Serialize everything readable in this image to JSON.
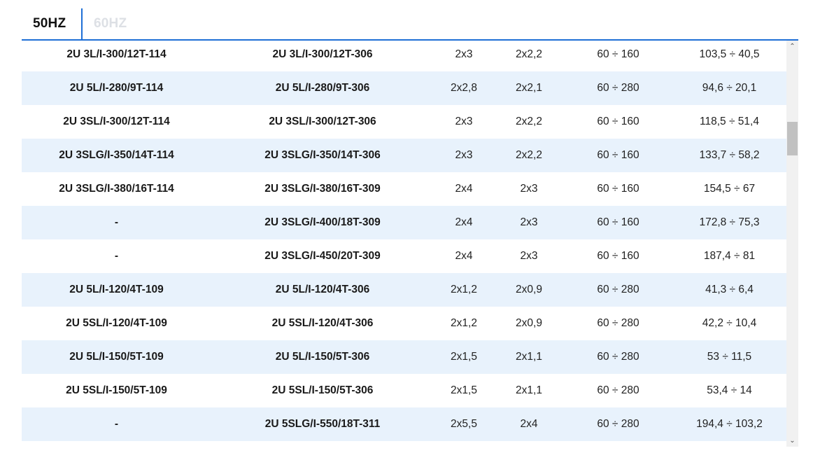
{
  "tabs": [
    {
      "label": "50HZ",
      "active": true
    },
    {
      "label": "60HZ",
      "active": false
    }
  ],
  "colors": {
    "accent": "#1f6fd6",
    "row_alt": "#e8f2fc",
    "inactive_tab": "#dde0e5"
  },
  "rows": [
    {
      "m1": "2U 3L/I-300/12T-114",
      "m2": "2U 3L/I-300/12T-306",
      "a": "2x3",
      "b": "2x2,2",
      "c": "60 ÷ 160",
      "d": "103,5 ÷ 40,5"
    },
    {
      "m1": "2U 5L/I-280/9T-114",
      "m2": "2U 5L/I-280/9T-306",
      "a": "2x2,8",
      "b": "2x2,1",
      "c": "60 ÷ 280",
      "d": "94,6 ÷ 20,1"
    },
    {
      "m1": "2U 3SL/I-300/12T-114",
      "m2": "2U 3SL/I-300/12T-306",
      "a": "2x3",
      "b": "2x2,2",
      "c": "60 ÷ 160",
      "d": "118,5 ÷ 51,4"
    },
    {
      "m1": "2U 3SLG/I-350/14T-114",
      "m2": "2U 3SLG/I-350/14T-306",
      "a": "2x3",
      "b": "2x2,2",
      "c": "60 ÷ 160",
      "d": "133,7 ÷ 58,2"
    },
    {
      "m1": "2U 3SLG/I-380/16T-114",
      "m2": "2U 3SLG/I-380/16T-309",
      "a": "2x4",
      "b": "2x3",
      "c": "60 ÷ 160",
      "d": "154,5 ÷ 67"
    },
    {
      "m1": "-",
      "m2": "2U 3SLG/I-400/18T-309",
      "a": "2x4",
      "b": "2x3",
      "c": "60 ÷ 160",
      "d": "172,8 ÷ 75,3"
    },
    {
      "m1": "-",
      "m2": "2U 3SLG/I-450/20T-309",
      "a": "2x4",
      "b": "2x3",
      "c": "60 ÷ 160",
      "d": "187,4 ÷ 81"
    },
    {
      "m1": "2U 5L/I-120/4T-109",
      "m2": "2U 5L/I-120/4T-306",
      "a": "2x1,2",
      "b": "2x0,9",
      "c": "60 ÷ 280",
      "d": "41,3 ÷ 6,4"
    },
    {
      "m1": "2U 5SL/I-120/4T-109",
      "m2": "2U 5SL/I-120/4T-306",
      "a": "2x1,2",
      "b": "2x0,9",
      "c": "60 ÷ 280",
      "d": "42,2 ÷ 10,4"
    },
    {
      "m1": "2U 5L/I-150/5T-109",
      "m2": "2U 5L/I-150/5T-306",
      "a": "2x1,5",
      "b": "2x1,1",
      "c": "60 ÷ 280",
      "d": "53 ÷ 11,5"
    },
    {
      "m1": "2U 5SL/I-150/5T-109",
      "m2": "2U 5SL/I-150/5T-306",
      "a": "2x1,5",
      "b": "2x1,1",
      "c": "60 ÷ 280",
      "d": "53,4 ÷ 14"
    },
    {
      "m1": "-",
      "m2": "2U 5SLG/I-550/18T-311",
      "a": "2x5,5",
      "b": "2x4",
      "c": "60 ÷ 280",
      "d": "194,4 ÷ 103,2"
    }
  ],
  "scrollbar": {
    "up_icon": "chevron-up-icon",
    "down_icon": "chevron-down-icon",
    "up_glyph": "⌃",
    "down_glyph": "⌄"
  }
}
